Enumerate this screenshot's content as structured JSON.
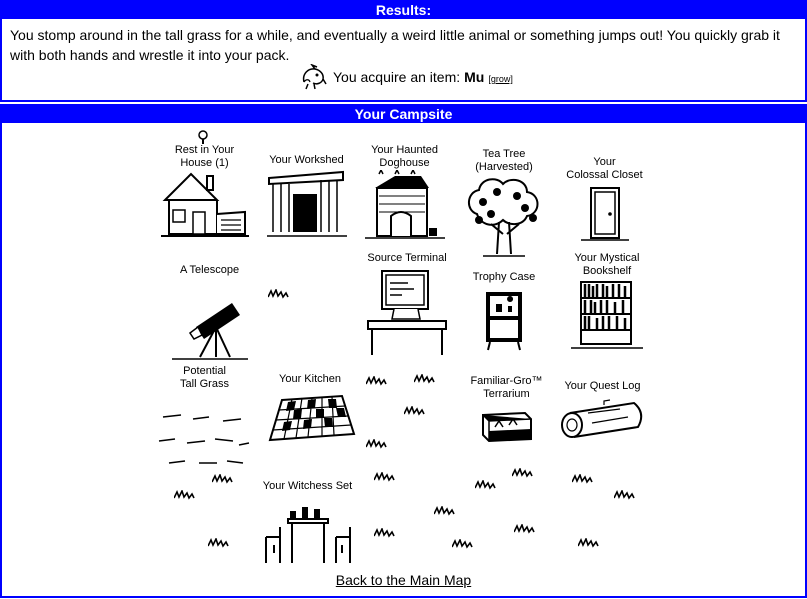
{
  "results": {
    "header": "Results:",
    "text": "You stomp around in the tall grass for a while, and eventually a weird little animal or something jumps out! You quickly grab it with both hands and wrestle it into your pack.",
    "acquire_prefix": "You acquire an item:",
    "item_name": "Mu",
    "grow_link": "[grow]",
    "item_icon": "mu-creature-icon"
  },
  "campsite": {
    "header": "Your Campsite",
    "items": [
      {
        "label_1": "Rest in Your",
        "label_2": "House (1)",
        "icon": "house-icon"
      },
      {
        "label_1": "Your Workshed",
        "icon": "workshed-icon"
      },
      {
        "label_1": "Your Haunted",
        "label_2": "Doghouse",
        "icon": "doghouse-icon"
      },
      {
        "label_1": "Tea Tree (Harvested)",
        "icon": "tea-tree-icon"
      },
      {
        "label_1": "Your",
        "label_2": "Colossal Closet",
        "icon": "closet-icon"
      },
      {
        "label_1": "A Telescope",
        "icon": "telescope-icon"
      },
      {
        "label_1": "Source Terminal",
        "icon": "terminal-icon"
      },
      {
        "label_1": "Trophy Case",
        "icon": "trophy-case-icon"
      },
      {
        "label_1": "Your Mystical",
        "label_2": "Bookshelf",
        "icon": "bookshelf-icon"
      },
      {
        "label_1": "Potential",
        "label_2": "Tall Grass",
        "icon": "tall-grass-icon"
      },
      {
        "label_1": "Your Kitchen",
        "icon": "kitchen-icon"
      },
      {
        "label_1": "Familiar-Gro™",
        "label_2": "Terrarium",
        "icon": "terrarium-icon"
      },
      {
        "label_1": "Your Quest Log",
        "icon": "log-icon"
      },
      {
        "label_1": "Your Witchess Set",
        "icon": "witchess-icon"
      }
    ],
    "back_link": "Back to the Main Map"
  }
}
